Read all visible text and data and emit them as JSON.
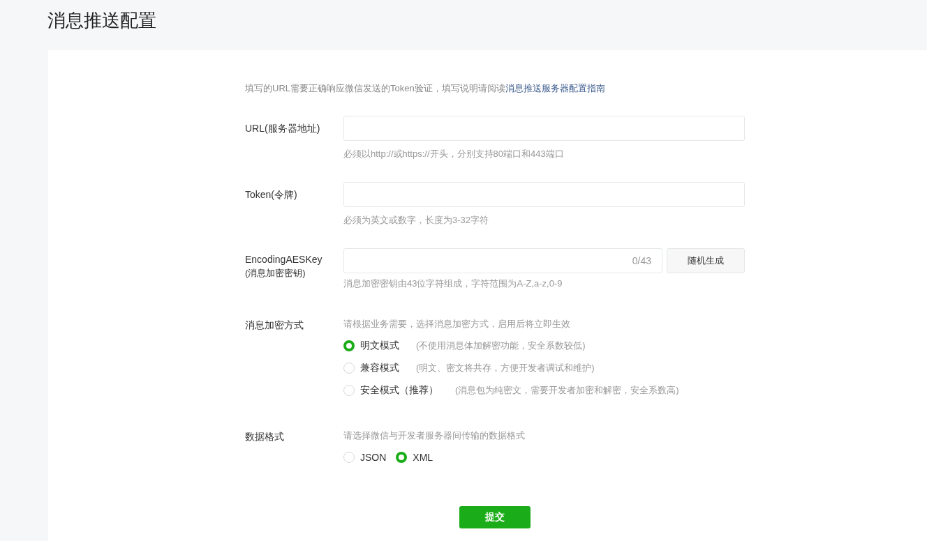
{
  "page_title": "消息推送配置",
  "intro": {
    "text": "填写的URL需要正确响应微信发送的Token验证，填写说明请阅读",
    "link": "消息推送服务器配置指南"
  },
  "fields": [
    {
      "kind": "text",
      "label": "URL(服务器地址)",
      "hint": "必须以http://或https://开头，分别支持80端口和443端口"
    },
    {
      "kind": "text",
      "label": "Token(令牌)",
      "hint": "必须为英文或数字，长度为3-32字符"
    },
    {
      "kind": "key",
      "label": "EncodingAESKey",
      "sublabel": "(消息加密密钥)",
      "counter": "0/43",
      "button": "随机生成",
      "hint": "消息加密密钥由43位字符组成，字符范围为A-Z,a-z,0-9"
    },
    {
      "kind": "radiolist",
      "label": "消息加密方式",
      "hint": "请根据业务需要，选择消息加密方式，启用后将立即生效",
      "options": [
        {
          "label": "明文模式",
          "note": "(不使用消息体加解密功能，安全系数较低)",
          "selected": true
        },
        {
          "label": "兼容模式",
          "note": "(明文、密文将共存，方便开发者调试和维护)",
          "selected": false
        },
        {
          "label": "安全模式（推荐）",
          "note": "(消息包为纯密文，需要开发者加密和解密，安全系数高)",
          "selected": false
        }
      ]
    },
    {
      "kind": "radiorow",
      "label": "数据格式",
      "hint": "请选择微信与开发者服务器间传输的数据格式",
      "options": [
        {
          "label": "JSON",
          "selected": false
        },
        {
          "label": "XML",
          "selected": true
        }
      ]
    }
  ],
  "submit": "提交"
}
